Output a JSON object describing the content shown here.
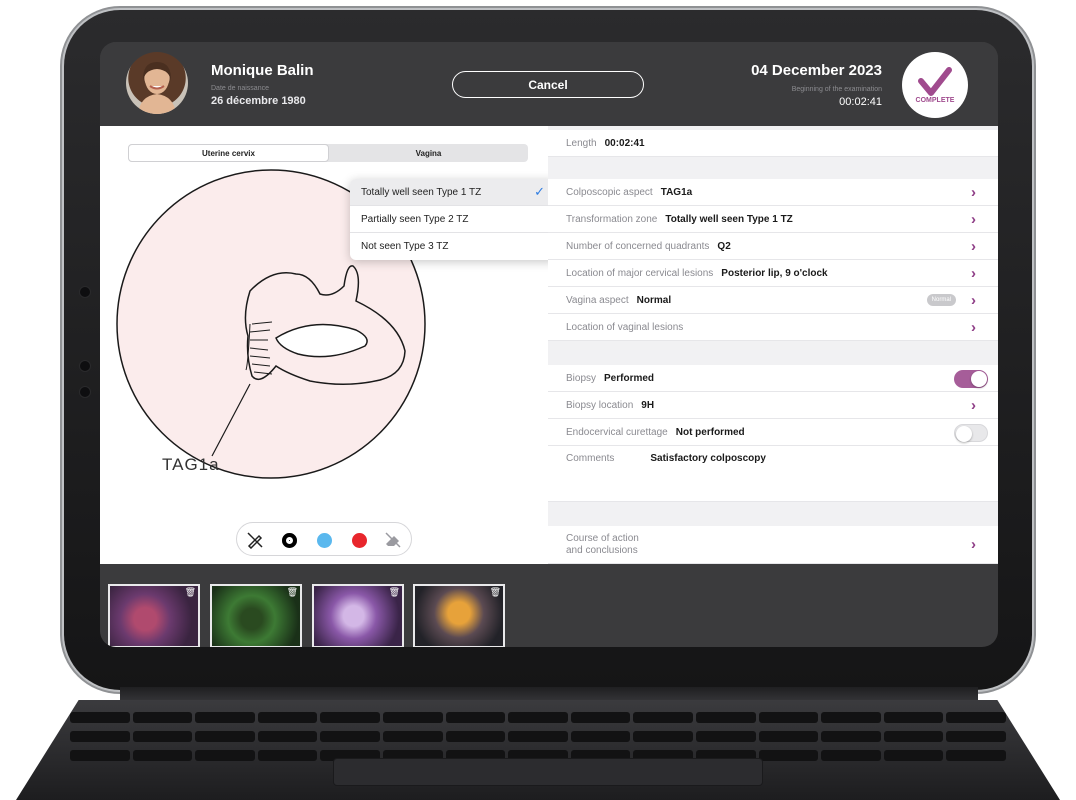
{
  "patient": {
    "name": "Monique Balin",
    "dob_label": "Date de naissance",
    "dob": "26 décembre 1980"
  },
  "header": {
    "cancel_label": "Cancel",
    "exam_date": "04 December 2023",
    "exam_sub": "Beginning of the examination",
    "exam_time": "00:02:41",
    "status_label": "COMPLETE"
  },
  "tabs": [
    {
      "label": "Uterine cervix",
      "active": true
    },
    {
      "label": "Vagina",
      "active": false
    }
  ],
  "dropdown": {
    "items": [
      {
        "label": "Totally well seen Type 1 TZ",
        "selected": true
      },
      {
        "label": "Partially seen Type 2 TZ",
        "selected": false
      },
      {
        "label": "Not seen Type 3 TZ",
        "selected": false
      }
    ]
  },
  "drawing": {
    "annotation": "TAG1a"
  },
  "tools": [
    {
      "icon": "pen-off-icon"
    },
    {
      "icon": "black-color-icon",
      "color": "#000000"
    },
    {
      "icon": "blue-color-icon",
      "color": "#5ab8ee"
    },
    {
      "icon": "red-color-icon",
      "color": "#e8262c"
    },
    {
      "icon": "eraser-icon"
    }
  ],
  "form": {
    "length_label": "Length",
    "length_value": "00:02:41",
    "colposcopic_label": "Colposcopic aspect",
    "colposcopic_value": "TAG1a",
    "tz_label": "Transformation zone",
    "tz_value": "Totally well seen Type 1 TZ",
    "quadrants_label": "Number of concerned quadrants",
    "quadrants_value": "Q2",
    "lesions_label": "Location of major cervical lesions",
    "lesions_value": "Posterior lip, 9 o'clock",
    "vagina_label": "Vagina aspect",
    "vagina_value": "Normal",
    "vagina_badge": "Normal",
    "vaginal_lesions_label": "Location of vaginal lesions",
    "biopsy_label": "Biopsy",
    "biopsy_value": "Performed",
    "biopsy_location_label": "Biopsy location",
    "biopsy_location_value": "9H",
    "curettage_label": "Endocervical curettage",
    "curettage_value": "Not performed",
    "comments_label": "Comments",
    "comments_value": "Satisfactory colposcopy",
    "course_label_line1": "Course of action",
    "course_label_line2": "and conclusions"
  },
  "colors": {
    "accent": "#a04b8e",
    "toggle_on": "#a65d99",
    "check_blue": "#2f7de1"
  }
}
